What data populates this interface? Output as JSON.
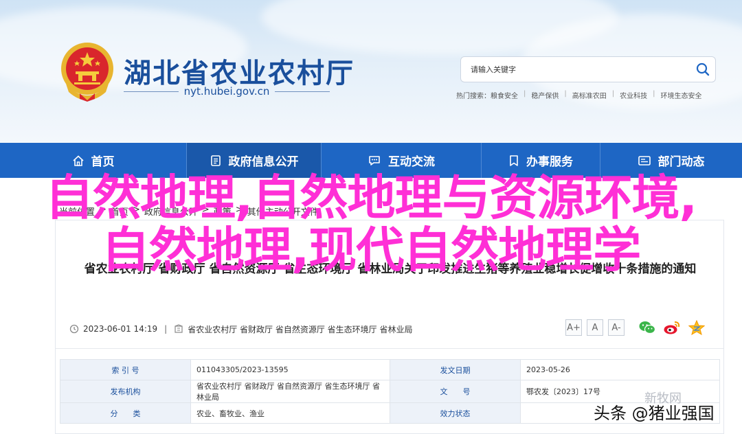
{
  "header": {
    "site_title": "湖北省农业农村厅",
    "site_domain": "nyt.hubei.gov.cn",
    "search_placeholder": "请输入关键字",
    "hotwords_label": "热门搜索：",
    "hotwords": [
      "粮食安全",
      "稳产保供",
      "高标准农田",
      "农业科技",
      "环境生态安全"
    ]
  },
  "nav": {
    "items": [
      {
        "label": "首页",
        "icon": "home-icon"
      },
      {
        "label": "政府信息公开",
        "icon": "document-icon"
      },
      {
        "label": "互动交流",
        "icon": "chat-icon"
      },
      {
        "label": "办事服务",
        "icon": "bookmark-icon"
      },
      {
        "label": "部门动态",
        "icon": "news-icon"
      }
    ]
  },
  "breadcrumb": {
    "items": [
      "当前位置",
      "首页",
      "政府信息公开",
      "政策",
      "其他主动公开文件"
    ],
    "sep": ">"
  },
  "article": {
    "title": "省农业农村厅 省财政厅 省自然资源厅 省生态环境厅 省林业局关于印发推进生猪等养殖业稳增长促增收十条措施的通知",
    "date": "2023-06-01 14:19",
    "sep": "|",
    "source": "省农业农村厅 省财政厅 省自然资源厅 省生态环境厅 省林业局",
    "font_buttons": [
      "A+",
      "A",
      "A-"
    ],
    "share_icons": [
      "wechat-icon",
      "weibo-icon",
      "qzone-icon"
    ]
  },
  "info_table": {
    "rows": [
      {
        "k1": "索 引 号",
        "v1": "011043305/2023-13595",
        "k2": "发文日期",
        "v2": "2023-05-26"
      },
      {
        "k1": "发布机构",
        "v1": "省农业农村厅 省财政厅 省自然资源厅 省生态环境厅 省林业局",
        "k2": "文　　号",
        "v2": "鄂农发〔2023〕17号"
      },
      {
        "k1": "分　　类",
        "v1": "农业、畜牧业、渔业",
        "k2": "效力状态",
        "v2": ""
      }
    ]
  },
  "overlay": {
    "line1": "自然地理,自然地理与资源环境,",
    "line2": "自然地理,现代自然地理学"
  },
  "watermark": {
    "text": "头条 @猪业强国",
    "ghost": "新牧网"
  },
  "colors": {
    "nav_bg": "#1e66c4",
    "title_blue": "#1a4f9c",
    "overlay_magenta": "#ff2fd6"
  }
}
